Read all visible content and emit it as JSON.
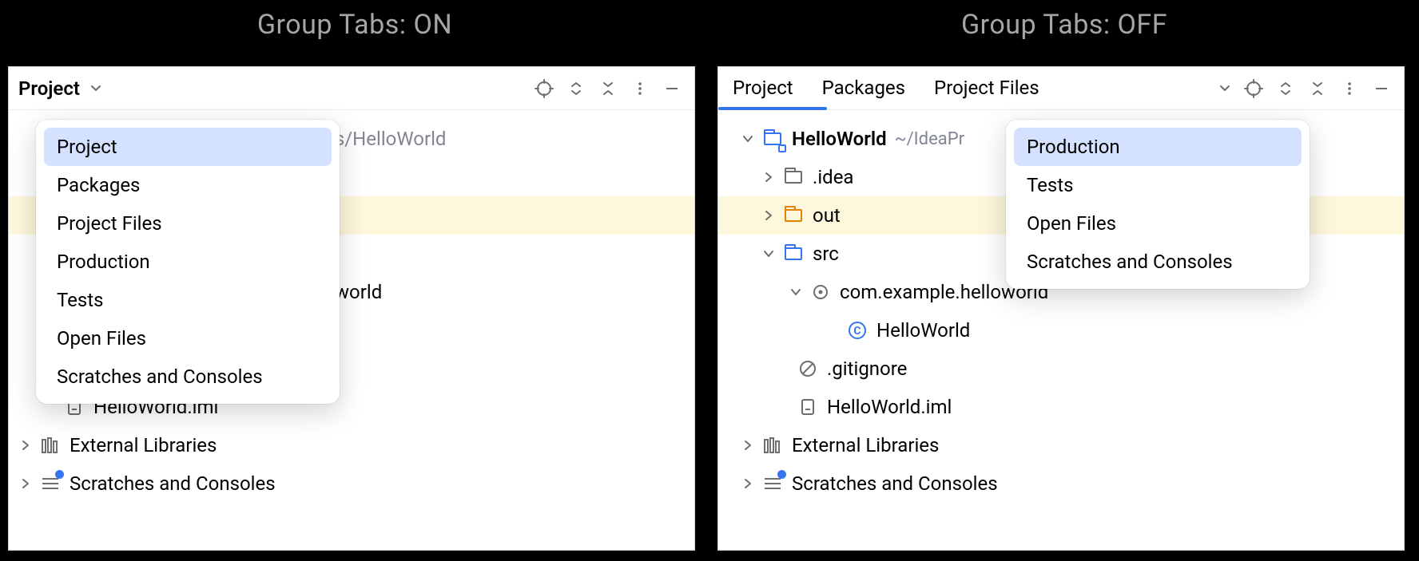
{
  "topbar": {
    "left": "Group Tabs: ON",
    "right": "Group Tabs: OFF"
  },
  "left": {
    "title": "Project",
    "popup": {
      "items": [
        "Project",
        "Packages",
        "Project Files",
        "Production",
        "Tests",
        "Open Files",
        "Scratches and Consoles"
      ],
      "selected": 0
    },
    "tree": {
      "root_path_fragment": "ts/HelloWorld",
      "pkg_fragment": "world",
      "iml": "HelloWorld.iml",
      "ext_lib": "External Libraries",
      "scratches": "Scratches and Consoles"
    }
  },
  "right": {
    "tabs": [
      "Project",
      "Packages",
      "Project Files"
    ],
    "active_tab": 0,
    "popup": {
      "items": [
        "Production",
        "Tests",
        "Open Files",
        "Scratches and Consoles"
      ],
      "selected": 0
    },
    "tree": {
      "root": "HelloWorld",
      "root_path": "~/IdeaPr",
      "idea": ".idea",
      "out": "out",
      "src": "src",
      "pkg": "com.example.helloworld",
      "cls": "HelloWorld",
      "gitignore": ".gitignore",
      "iml": "HelloWorld.iml",
      "ext_lib": "External Libraries",
      "scratches": "Scratches and Consoles"
    }
  }
}
